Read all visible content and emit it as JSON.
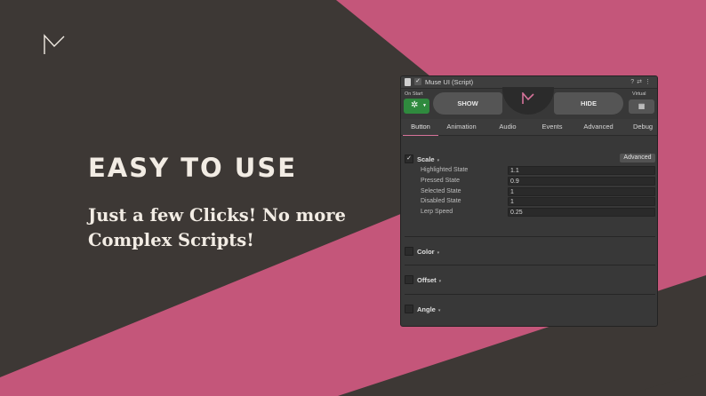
{
  "headline": "EASY TO USE",
  "subline": "Just a few Clicks! No more Complex Scripts!",
  "colors": {
    "background": "#3d3835",
    "accent_pink": "#c4567a",
    "text_light": "#f2ece4",
    "panel_bg": "#383838",
    "onstart_green": "#2f8a3e"
  },
  "panel": {
    "title": "Muse UI (Script)",
    "header_icons": [
      "help-icon",
      "preset-icon",
      "more-menu-icon"
    ],
    "on_start_label": "On Start",
    "virtual_label": "Virtual",
    "show_label": "SHOW",
    "hide_label": "HIDE",
    "tabs": [
      {
        "label": "Button",
        "active": true
      },
      {
        "label": "Animation",
        "active": false
      },
      {
        "label": "Audio",
        "active": false
      },
      {
        "label": "Events",
        "active": false
      },
      {
        "label": "Advanced",
        "active": false
      },
      {
        "label": "Debug",
        "active": false
      }
    ],
    "scale": {
      "title": "Scale",
      "enabled": true,
      "advanced_label": "Advanced",
      "properties": [
        {
          "label": "Highlighted State",
          "value": "1.1"
        },
        {
          "label": "Pressed State",
          "value": "0.9"
        },
        {
          "label": "Selected State",
          "value": "1"
        },
        {
          "label": "Disabled State",
          "value": "1"
        },
        {
          "label": "Lerp Speed",
          "value": "0.25"
        }
      ]
    },
    "sections": [
      {
        "title": "Color",
        "enabled": false
      },
      {
        "title": "Offset",
        "enabled": false
      },
      {
        "title": "Angle",
        "enabled": false
      }
    ]
  }
}
